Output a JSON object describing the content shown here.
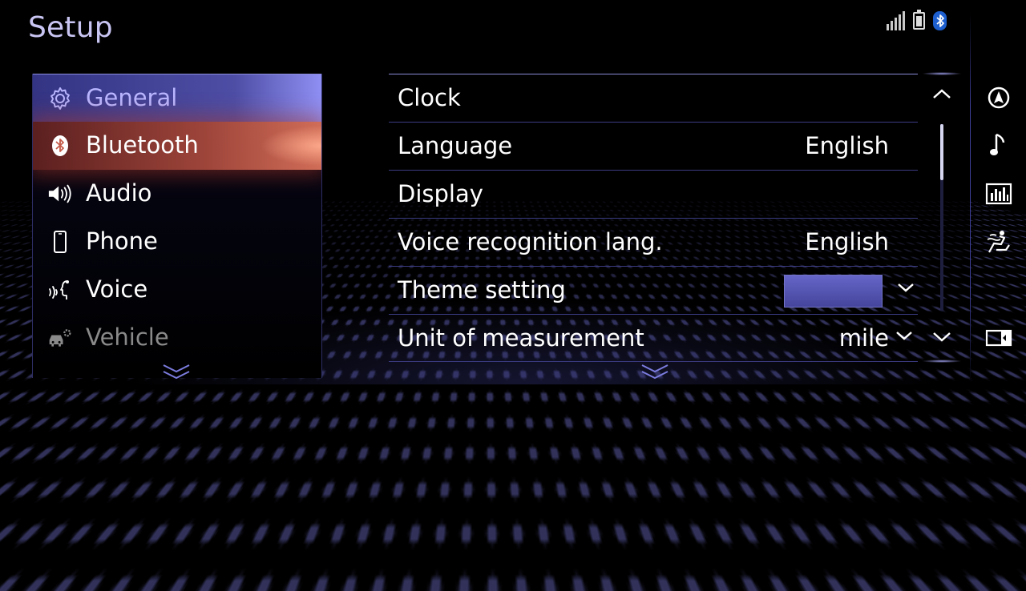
{
  "screen": {
    "title": "Setup"
  },
  "status_bar": {
    "icons": [
      "signal-strength-icon",
      "battery-icon",
      "bluetooth-status-icon"
    ],
    "bluetooth_color": "#1d5fcf"
  },
  "menu": {
    "items": [
      {
        "label": "General",
        "icon": "gear-icon",
        "state": "selected"
      },
      {
        "label": "Bluetooth",
        "icon": "bluetooth-icon",
        "state": "focused"
      },
      {
        "label": "Audio",
        "icon": "speaker-icon",
        "state": "normal"
      },
      {
        "label": "Phone",
        "icon": "phone-icon",
        "state": "normal"
      },
      {
        "label": "Voice",
        "icon": "voice-icon",
        "state": "normal"
      },
      {
        "label": "Vehicle",
        "icon": "vehicle-settings-icon",
        "state": "disabled"
      }
    ]
  },
  "settings": {
    "rows": [
      {
        "label": "Clock",
        "value": ""
      },
      {
        "label": "Language",
        "value": "English"
      },
      {
        "label": "Display",
        "value": ""
      },
      {
        "label": "Voice recognition lang.",
        "value": "English"
      },
      {
        "label": "Theme setting",
        "value": "",
        "swatch_color": "#5656b4"
      },
      {
        "label": "Unit of measurement",
        "value": "mile"
      }
    ],
    "scroll_position": 0
  },
  "rail": {
    "buttons": [
      "navigation-icon",
      "music-note-icon",
      "equalizer-icon",
      "climate-seat-icon",
      "split-screen-icon"
    ]
  },
  "colors": {
    "accent": "#8d8de0",
    "selected_text": "#b9b6ff",
    "focus_glow": "#c8503c",
    "title": "#c9c5f3"
  }
}
